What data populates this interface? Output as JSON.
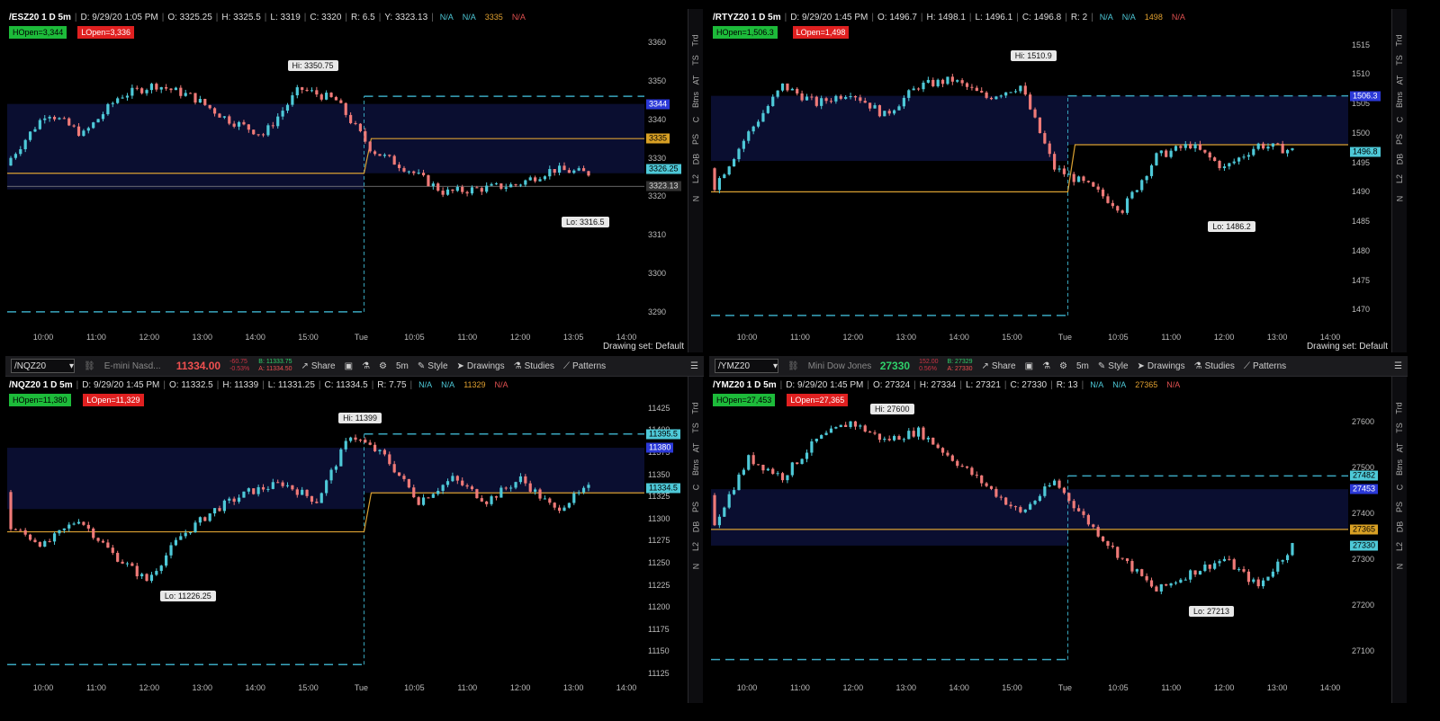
{
  "colors": {
    "up": "#4ec9d8",
    "down": "#ef7a78",
    "hiline": "#3aa7bf",
    "midline": "#d9a032",
    "band": "#0b0f35"
  },
  "panes": [
    {
      "toolbar": null,
      "header": {
        "title": "/ESZ20 1 D 5m",
        "date": "D: 9/29/20 1:05 PM",
        "o": "O: 3325.25",
        "h": "H: 3325.5",
        "l": "L: 3319",
        "c": "C: 3320",
        "r": "R: 6.5",
        "y": "Y: 3323.13",
        "na1": "N/A",
        "na2": "N/A",
        "val": "3335",
        "na3": "N/A"
      },
      "hopen": "HOpen=3,344",
      "lopen": "LOpen=3,336",
      "yticks": [
        "3360",
        "3350",
        "3340",
        "3330",
        "3320",
        "3310",
        "3300",
        "3290"
      ],
      "ymin": 3286,
      "ymax": 3364,
      "price_labels": [
        {
          "text": "3344",
          "v": 3344,
          "bg": "#2b39d8",
          "fg": "#fff"
        },
        {
          "text": "3335",
          "v": 3335,
          "bg": "#d8a024",
          "fg": "#000"
        },
        {
          "text": "3326.25",
          "v": 3327,
          "bg": "#4ec9d8",
          "fg": "#000"
        },
        {
          "text": "3323.13",
          "v": 3322.6,
          "bg": "#333",
          "fg": "#ddd"
        }
      ],
      "hi": {
        "text": "Hi: 3350.75",
        "v": 3350.75
      },
      "lo": {
        "text": "Lo: 3316.5",
        "v": 3316.5
      },
      "xticks": [
        "10:00",
        "11:00",
        "12:00",
        "13:00",
        "14:00",
        "15:00",
        "Tue",
        "10:05",
        "11:00",
        "12:00",
        "13:05",
        "14:00"
      ],
      "footer": "Drawing set: Default",
      "series": {
        "start": 3328,
        "waypoints": [
          3330,
          3342,
          3336,
          3346,
          3349,
          3346,
          3340,
          3336,
          3348,
          3345,
          3332,
          3327,
          3321,
          3322,
          3323,
          3327,
          3326
        ],
        "line1": 3326,
        "line2": 3335,
        "band_top": 3344,
        "band_bot": 3326,
        "ref": 3322.6,
        "dash_hi": 3346,
        "dash_lo": 3290
      }
    },
    {
      "toolbar": null,
      "header": {
        "title": "/RTYZ20 1 D 5m",
        "date": "D: 9/29/20 1:45 PM",
        "o": "O: 1496.7",
        "h": "H: 1498.1",
        "l": "L: 1496.1",
        "c": "C: 1496.8",
        "r": "R: 2",
        "na1": "N/A",
        "na2": "N/A",
        "val": "1498",
        "na3": "N/A"
      },
      "hopen": "HOpen=1,506.3",
      "lopen": "LOpen=1,498",
      "yticks": [
        "1515",
        "1510",
        "1505",
        "1500",
        "1495",
        "1490",
        "1485",
        "1480",
        "1475",
        "1470"
      ],
      "ymin": 1467,
      "ymax": 1518,
      "price_labels": [
        {
          "text": "1506.3",
          "v": 1506.3,
          "bg": "#2b39d8",
          "fg": "#fff"
        },
        {
          "text": "1496.8",
          "v": 1496.8,
          "bg": "#4ec9d8",
          "fg": "#000"
        }
      ],
      "hi": {
        "text": "Hi: 1510.9",
        "v": 1510.9
      },
      "lo": {
        "text": "Lo: 1486.2",
        "v": 1486.2
      },
      "xticks": [
        "10:00",
        "11:00",
        "12:00",
        "13:00",
        "14:00",
        "15:00",
        "Tue",
        "10:05",
        "11:00",
        "12:00",
        "13:00",
        "14:00"
      ],
      "footer": "Drawing set: Default",
      "series": {
        "start": 1494,
        "waypoints": [
          1491,
          1500,
          1508,
          1505,
          1507,
          1503,
          1508,
          1509,
          1506,
          1508,
          1494,
          1491,
          1487,
          1496,
          1498,
          1494,
          1498,
          1497
        ],
        "line1": 1490,
        "line2": 1498,
        "band_top": 1506.3,
        "band_bot": 1498,
        "dash_hi": 1506.3,
        "dash_lo": 1469
      }
    },
    {
      "toolbar": {
        "symbol": "/NQZ20",
        "desc": "E-mini Nasd...",
        "price": "11334.00",
        "price_color": "#ef5050",
        "chg1": "-60.75",
        "chg2": "-0.53%",
        "bid": "B: 11333.75",
        "ask": "A: 11334.50",
        "share": "Share",
        "tf": "5m",
        "style": "Style",
        "drawings": "Drawings",
        "studies": "Studies",
        "patterns": "Patterns"
      },
      "header": {
        "title": "/NQZ20 1 D 5m",
        "date": "D: 9/29/20 1:45 PM",
        "o": "O: 11332.5",
        "h": "H: 11339",
        "l": "L: 11331.25",
        "c": "C: 11334.5",
        "r": "R: 7.75",
        "na1": "N/A",
        "na2": "N/A",
        "val": "11329",
        "na3": "N/A"
      },
      "hopen": "HOpen=11,380",
      "lopen": "LOpen=11,329",
      "yticks": [
        "11425",
        "11400",
        "11375",
        "11350",
        "11325",
        "11300",
        "11275",
        "11250",
        "11225",
        "11200",
        "11175",
        "11150",
        "11125"
      ],
      "ymin": 11120,
      "ymax": 11440,
      "price_labels": [
        {
          "text": "11395.5",
          "v": 11395.5,
          "bg": "#4ec9d8",
          "fg": "#000"
        },
        {
          "text": "11380",
          "v": 11380,
          "bg": "#2b39d8",
          "fg": "#fff"
        },
        {
          "text": "11334.5",
          "v": 11334.5,
          "bg": "#4ec9d8",
          "fg": "#000"
        }
      ],
      "hi": {
        "text": "Hi: 11399",
        "v": 11399
      },
      "lo": {
        "text": "Lo: 11226.25",
        "v": 11226.25
      },
      "xticks": [
        "10:00",
        "11:00",
        "12:00",
        "13:00",
        "14:00",
        "15:00",
        "Tue",
        "10:05",
        "11:00",
        "12:00",
        "13:00",
        "14:00"
      ],
      "footer": "",
      "series": {
        "start": 11330,
        "waypoints": [
          11290,
          11270,
          11300,
          11260,
          11230,
          11280,
          11310,
          11330,
          11340,
          11320,
          11395,
          11370,
          11320,
          11345,
          11320,
          11345,
          11310,
          11334
        ],
        "line1": 11285,
        "line2": 11329,
        "band_top": 11380,
        "band_bot": 11329,
        "dash_hi": 11395.5,
        "dash_lo": 11135
      }
    },
    {
      "toolbar": {
        "symbol": "/YMZ20",
        "desc": "Mini Dow Jones I...",
        "price": "27330",
        "price_color": "#2fd06a",
        "chg1": "152.00",
        "chg2": "0.56%",
        "bid": "B: 27329",
        "ask": "A: 27330",
        "share": "Share",
        "tf": "5m",
        "style": "Style",
        "drawings": "Drawings",
        "studies": "Studies",
        "patterns": "Patterns"
      },
      "header": {
        "title": "/YMZ20 1 D 5m",
        "date": "D: 9/29/20 1:45 PM",
        "o": "O: 27324",
        "h": "H: 27334",
        "l": "L: 27321",
        "c": "C: 27330",
        "r": "R: 13",
        "na1": "N/A",
        "na2": "N/A",
        "val": "27365",
        "na3": "N/A"
      },
      "hopen": "HOpen=27,453",
      "lopen": "LOpen=27,365",
      "yticks": [
        "27600",
        "27500",
        "27400",
        "27300",
        "27200",
        "27100"
      ],
      "ymin": 27040,
      "ymax": 27660,
      "price_labels": [
        {
          "text": "27482",
          "v": 27482,
          "bg": "#4ec9d8",
          "fg": "#000"
        },
        {
          "text": "27453",
          "v": 27453,
          "bg": "#2b39d8",
          "fg": "#fff"
        },
        {
          "text": "27365",
          "v": 27365,
          "bg": "#d8a024",
          "fg": "#000"
        },
        {
          "text": "27330",
          "v": 27330,
          "bg": "#4ec9d8",
          "fg": "#000"
        }
      ],
      "hi": {
        "text": "Hi: 27600",
        "v": 27600
      },
      "lo": {
        "text": "Lo: 27213",
        "v": 27213
      },
      "xticks": [
        "10:00",
        "11:00",
        "12:00",
        "13:00",
        "14:00",
        "15:00",
        "Tue",
        "10:05",
        "11:00",
        "12:00",
        "13:00",
        "14:00"
      ],
      "footer": "",
      "series": {
        "start": 27440,
        "waypoints": [
          27380,
          27520,
          27480,
          27560,
          27600,
          27560,
          27580,
          27520,
          27460,
          27400,
          27470,
          27380,
          27300,
          27230,
          27270,
          27300,
          27240,
          27330
        ],
        "line1": 27365,
        "line2": 27365,
        "band_top": 27453,
        "band_bot": 27365,
        "dash_hi": 27482,
        "dash_lo": 27080
      }
    }
  ],
  "sidebar": [
    "Trd",
    "TS",
    "AT",
    "Btns",
    "C",
    "PS",
    "DB",
    "L2",
    "N"
  ]
}
